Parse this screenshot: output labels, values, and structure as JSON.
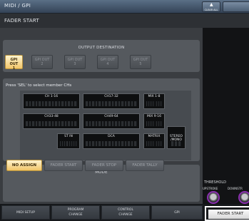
{
  "window": {
    "title": "MIDI / GPI",
    "clear_all_label": "CLEAR ALL"
  },
  "page": {
    "title": "FADER START"
  },
  "output_destination": {
    "title": "OUTPUT DESTINATION",
    "buttons": [
      {
        "l1": "GPI OUT",
        "l2": "1",
        "active": true
      },
      {
        "l1": "GPI OUT",
        "l2": "2",
        "active": false
      },
      {
        "l1": "GPI OUT",
        "l2": "3",
        "active": false
      },
      {
        "l1": "GPI OUT",
        "l2": "4",
        "active": false
      },
      {
        "l1": "GPI OUT",
        "l2": "5",
        "active": false
      }
    ]
  },
  "channels": {
    "instruction": "Press 'SEL' to select member CHs",
    "groups": [
      {
        "label": "CH 1-16"
      },
      {
        "label": "CH17-32"
      },
      {
        "label": "MIX 1-8"
      },
      {
        "label": "CH33-48"
      },
      {
        "label": "CH49-64"
      },
      {
        "label": "MIX 9-16"
      },
      {
        "label": "ST IN"
      },
      {
        "label": "DCA"
      },
      {
        "label": "MATRIX"
      },
      {
        "label": "STEREO /MONO"
      }
    ]
  },
  "mode": {
    "title": "MODE",
    "buttons": [
      {
        "label": "NO ASSIGN",
        "active": true
      },
      {
        "label": "FADER START",
        "active": false
      },
      {
        "label": "FADER STOP",
        "active": false
      },
      {
        "label": "FADER TALLY",
        "active": false
      }
    ]
  },
  "threshold": {
    "title": "THRESHOLD",
    "upstroke": "UPSTROKE",
    "downstroke": "DOWNSTR"
  },
  "tabs": [
    {
      "line1": "MIDI SETUP",
      "line2": ""
    },
    {
      "line1": "PROGRAM",
      "line2": "CHANGE"
    },
    {
      "line1": "CONTROL",
      "line2": "CHANGE"
    },
    {
      "line1": "GPI",
      "line2": ""
    }
  ],
  "fader_start_tab": {
    "label": "FADER START"
  },
  "colors": {
    "active_button": "#f3c66a",
    "knob_ring": "#8b2fb0",
    "titlebar": "#4a5d72"
  }
}
